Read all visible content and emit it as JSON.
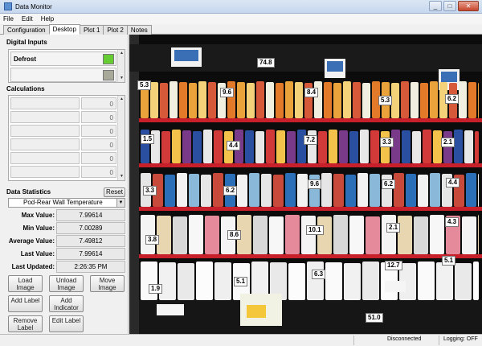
{
  "window": {
    "title": "Data Monitor"
  },
  "menu": [
    "File",
    "Edit",
    "Help"
  ],
  "tabs": [
    "Configuration",
    "Desktop",
    "Plot 1",
    "Plot 2",
    "Notes"
  ],
  "active_tab": "Desktop",
  "digital_inputs": {
    "title": "Digital Inputs",
    "items": [
      {
        "label": "Defrost",
        "led_color": "#66cc33"
      },
      {
        "label": "",
        "led_color": "#a9a99a"
      }
    ]
  },
  "calculations": {
    "title": "Calculations",
    "rows": [
      {
        "value": "0"
      },
      {
        "value": "0"
      },
      {
        "value": "0"
      },
      {
        "value": "0"
      },
      {
        "value": "0"
      },
      {
        "value": "0"
      }
    ]
  },
  "data_statistics": {
    "title": "Data Statistics",
    "reset_label": "Reset",
    "selected_channel": "Pod-Rear Wall Temperature",
    "rows": [
      {
        "label": "Max Value:",
        "value": "7.99614"
      },
      {
        "label": "Min Value:",
        "value": "7.00289"
      },
      {
        "label": "Average Value:",
        "value": "7.49812"
      },
      {
        "label": "Last Value:",
        "value": "7.99614"
      },
      {
        "label": "Last Updated:",
        "value": "2:26:35 PM"
      }
    ]
  },
  "buttons": {
    "load_image": "Load Image",
    "unload_image": "Unload Image",
    "move_image": "Move Image",
    "add_label": "Add Label",
    "add_indicator": "Add Indicator",
    "remove_label": "Remove Label",
    "edit_label": "Edit Label"
  },
  "image_labels": [
    "74.8",
    "5.3",
    "9.6",
    "8.4",
    "5.3",
    "6.2",
    "1.5",
    "4.4",
    "7.2",
    "3.3",
    "2.1",
    "3.3",
    "6.2",
    "9.6",
    "6.2",
    "4.4",
    "3.8",
    "8.6",
    "10.1",
    "2.1",
    "4.3",
    "12.7",
    "5.1",
    "1.9",
    "5.1",
    "6.3",
    "51.0"
  ],
  "status": {
    "connection": "Disconnected",
    "logging": "Logging: OFF"
  },
  "colors": {
    "accent": "#3a6fb5",
    "shelf": "#c8202a",
    "led_on": "#66cc33"
  }
}
